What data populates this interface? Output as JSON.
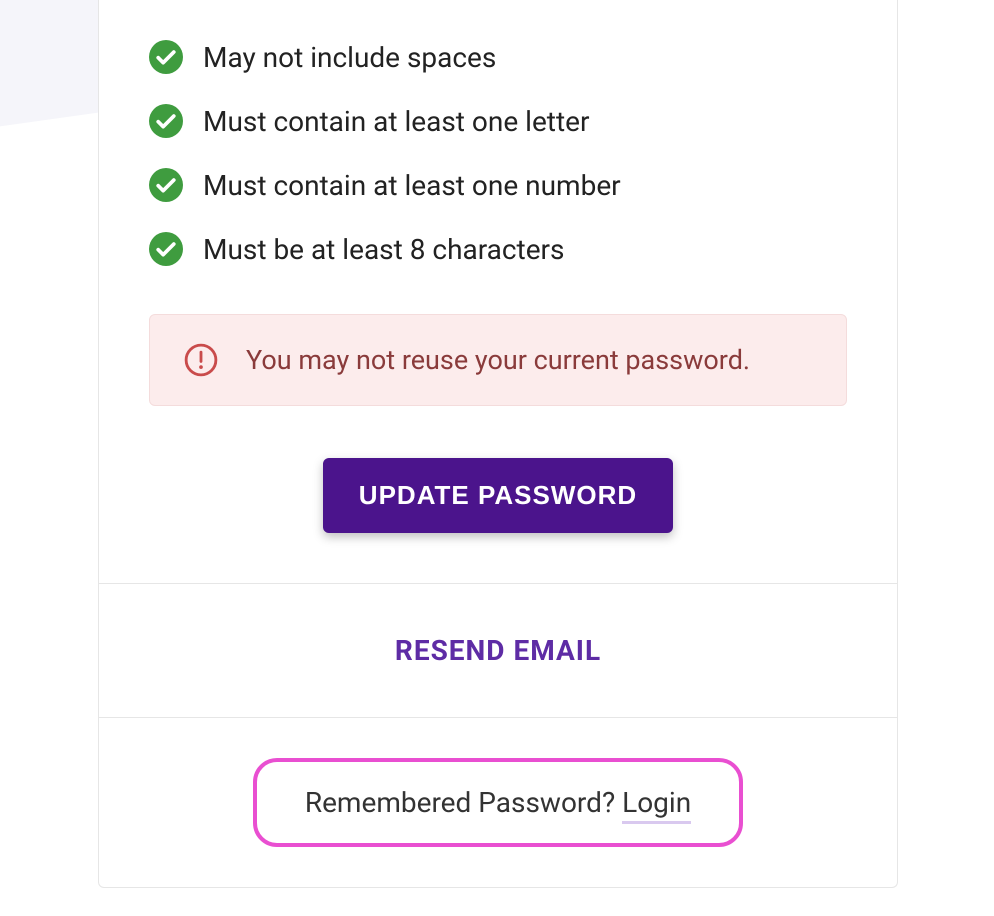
{
  "rules": {
    "0": {
      "text": "May not include spaces"
    },
    "1": {
      "text": "Must contain at least one letter"
    },
    "2": {
      "text": "Must contain at least one number"
    },
    "3": {
      "text": "Must be at least 8 characters"
    }
  },
  "alert": {
    "message": "You may not reuse your current password."
  },
  "buttons": {
    "update_password": "UPDATE PASSWORD",
    "resend_email": "RESEND EMAIL"
  },
  "footer": {
    "remembered_text": "Remembered Password? ",
    "login_label": "Login"
  },
  "colors": {
    "primary": "#4b148c",
    "success": "#3f9c3f",
    "alert_bg": "#fcecec",
    "alert_fg": "#8a3b3b",
    "highlight_border": "#e94fd1"
  }
}
